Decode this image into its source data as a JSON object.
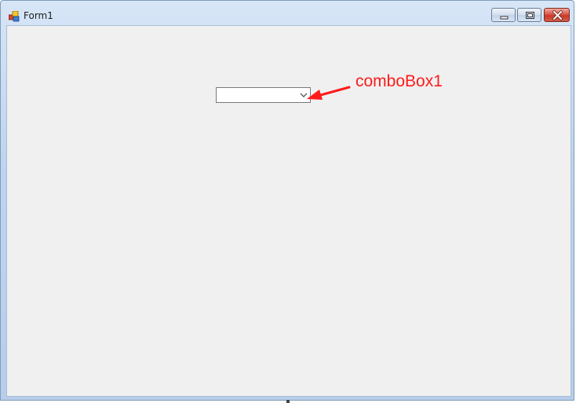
{
  "window": {
    "title": "Form1",
    "icon": "winforms-app-icon",
    "controls": [
      "minimize-icon",
      "maximize-icon",
      "close-icon"
    ]
  },
  "combobox": {
    "selected_value": "",
    "icon": "chevron-down-icon"
  },
  "annotation": {
    "label": "comboBox1",
    "color": "#ff1a1a"
  },
  "colors": {
    "client_background": "#f0f0f0",
    "close_button": "#c8382a"
  }
}
